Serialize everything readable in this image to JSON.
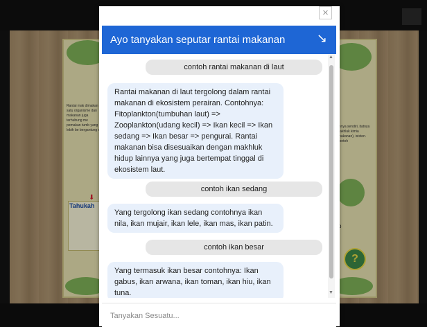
{
  "background": {
    "tahukah_label": "Tahukah",
    "help_icon_glyph": "?",
    "letter_p": "p",
    "left_paragraph": "Rantai mak dimakan satu organisme dan makanan juga terhubung me pemakan tumb yang lebih be bergantung ca",
    "right_paragraph": "annya sendiri, itatnya makhluk kimia (makanan), isisten. Contoh"
  },
  "chat": {
    "close_glyph": "×",
    "header_title": "Ayo tanyakan seputar rantai makanan",
    "minimize_glyph": "↘",
    "messages": [
      {
        "role": "user",
        "text": "contoh rantai makanan di laut"
      },
      {
        "role": "bot",
        "text": "Rantai makanan di laut tergolong dalam rantai makanan di ekosistem perairan. Contohnya: Fitoplankton(tumbuhan laut) => Zooplankton(udang kecil) => Ikan kecil => Ikan sedang => Ikan besar => pengurai. Rantai makanan bisa disesuaikan dengan makhluk hidup lainnya yang juga bertempat tinggal di ekosistem laut."
      },
      {
        "role": "user",
        "text": "contoh ikan sedang"
      },
      {
        "role": "bot",
        "text": "Yang tergolong ikan sedang contohnya ikan nila, ikan mujair, ikan lele, ikan mas, ikan patin."
      },
      {
        "role": "user",
        "text": "contoh ikan besar"
      },
      {
        "role": "bot",
        "text": "Yang termasuk ikan besar contohnya: Ikan gabus, ikan arwana, ikan toman, ikan hiu, ikan tuna."
      }
    ],
    "input_placeholder": "Tanyakan Sesuatu..."
  },
  "colors": {
    "header_blue": "#1e66d5",
    "bot_bubble": "#e8f0fb",
    "user_bubble": "#e6e6e6"
  }
}
